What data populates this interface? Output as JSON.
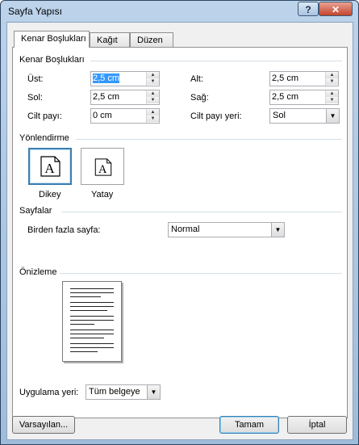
{
  "window": {
    "title": "Sayfa Yapısı",
    "help_glyph": "?",
    "close_glyph": "✕"
  },
  "tabs": [
    {
      "label": "Kenar Boşlukları",
      "active": true
    },
    {
      "label": "Kağıt",
      "active": false
    },
    {
      "label": "Düzen",
      "active": false
    }
  ],
  "margins": {
    "heading": "Kenar Boşlukları",
    "top": {
      "label": "Üst:",
      "value": "2,5 cm"
    },
    "bottom": {
      "label": "Alt:",
      "value": "2,5 cm"
    },
    "left": {
      "label": "Sol:",
      "value": "2,5 cm"
    },
    "right": {
      "label": "Sağ:",
      "value": "2,5 cm"
    },
    "gutter": {
      "label": "Cilt payı:",
      "value": "0 cm"
    },
    "gutter_pos": {
      "label": "Cilt payı yeri:",
      "value": "Sol"
    }
  },
  "orientation": {
    "heading": "Yönlendirme",
    "portrait": {
      "label": "Dikey",
      "glyph": "A",
      "selected": true
    },
    "landscape": {
      "label": "Yatay",
      "glyph": "A",
      "selected": false
    }
  },
  "pages": {
    "heading": "Sayfalar",
    "multiple": {
      "label": "Birden fazla sayfa:",
      "value": "Normal"
    }
  },
  "preview": {
    "heading": "Önizleme"
  },
  "apply": {
    "label": "Uygulama yeri:",
    "value": "Tüm belgeye"
  },
  "buttons": {
    "default": "Varsayılan...",
    "ok": "Tamam",
    "cancel": "İptal"
  },
  "colors": {
    "selection": "#3399ff",
    "focus_border": "#3c7fb1"
  }
}
